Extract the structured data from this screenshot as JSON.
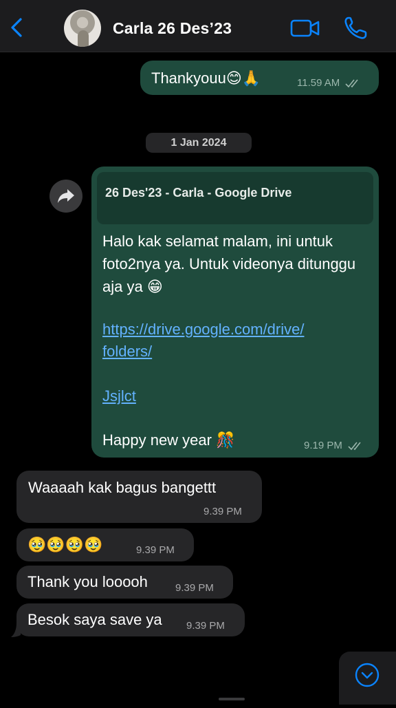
{
  "header": {
    "contact_name": "Carla 26 Des’23",
    "back_icon": "chevron-left-icon",
    "video_icon": "video-camera-icon",
    "call_icon": "phone-icon",
    "accent_color": "#0a84ff"
  },
  "messages": [
    {
      "direction": "outgoing",
      "text": "Thankyouu😊🙏",
      "time": "11.59 AM",
      "status": "read"
    },
    {
      "type": "date_separator",
      "text": "1 Jan 2024"
    },
    {
      "direction": "outgoing",
      "link_preview_title": "26 Des'23 - Carla - Google Drive",
      "text": "Halo kak selamat malam, ini untuk foto2nya ya. Untuk videonya ditunggu aja ya 😁",
      "link_line1": "https://drive.google.com/drive/",
      "link_line2": "folders/",
      "link2": "Jsjlct",
      "closing": "Happy new year 🎊",
      "time": "9.19 PM",
      "status": "read"
    },
    {
      "direction": "incoming",
      "text": "Waaaah kak bagus bangettt",
      "time": "9.39 PM"
    },
    {
      "direction": "incoming",
      "text": "🥹🥹🥹🥹",
      "time": "9.39 PM"
    },
    {
      "direction": "incoming",
      "text": "Thank you looooh",
      "time": "9.39 PM"
    },
    {
      "direction": "incoming",
      "text": "Besok saya save ya",
      "time": "9.39 PM"
    }
  ],
  "controls": {
    "forward_icon": "forward-arrow-icon",
    "scroll_down_icon": "chevron-down-circle-icon"
  },
  "colors": {
    "outgoing_bubble": "#1f4b3d",
    "incoming_bubble": "#262628",
    "link": "#63b2ff"
  }
}
